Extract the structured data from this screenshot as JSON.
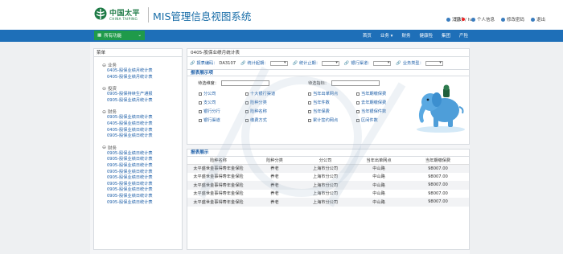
{
  "header": {
    "logo_cn": "中国太平",
    "logo_en": "CHINA TAIPING",
    "system_title": "MIS管理信息视图系统",
    "user_greeting": "您好 / hai",
    "links": [
      {
        "label": "消息",
        "icon": "mail-icon"
      },
      {
        "label": "个人信息",
        "icon": "user-icon"
      },
      {
        "label": "修改密码",
        "icon": "edit-icon"
      },
      {
        "label": "退出",
        "icon": "power-icon"
      }
    ]
  },
  "nav": {
    "functions_label": "所有功能",
    "items": [
      "首页",
      "业务",
      "财务",
      "健康险",
      "集团",
      "产险"
    ]
  },
  "sidebar": {
    "title": "菜单",
    "groups": [
      {
        "label": "业务",
        "items": [
          "0405-股保业绩月统计表",
          "0405-股保业绩月统计表"
        ]
      },
      {
        "label": "投资",
        "items": [
          "0905-股保持续生产通报",
          "0905-股保业绩月统计表"
        ]
      },
      {
        "label": "财务",
        "items": [
          "0905-股保业绩日统计表",
          "0405-股保业绩日统计表",
          "0405-股保业绩日统计表",
          "0905-股保业绩日统计表"
        ]
      },
      {
        "label": "财务",
        "items": [
          "0905-股保业绩日统计表",
          "0905-股保业绩日统计表",
          "0905-股保业绩日统计表",
          "0905-股保业绩日统计表",
          "0905-股保业绩日统计表",
          "0905-股保业绩日统计表",
          "0905-股保业绩日统计表",
          "0905-股保业绩日统计表",
          "0905-股保业绩日统计表"
        ]
      }
    ]
  },
  "main": {
    "panel_title": "0405-股保业绩月统计表",
    "filters": [
      {
        "label": "报表编码：",
        "value": "DA3107"
      },
      {
        "label": "统计起期：",
        "value": ""
      },
      {
        "label": "统计止期：",
        "value": ""
      },
      {
        "label": "银行渠道：",
        "value": ""
      },
      {
        "label": "业务类型：",
        "value": ""
      }
    ],
    "indicator_section": "报表展示项",
    "dim_search_label": "待选维度：",
    "metric_search_label": "待选指标：",
    "dimensions": [
      "分公司",
      "十大银行渠道",
      "支公司",
      "险种分类",
      "银行分行",
      "险种名称",
      "银行渠道",
      "缴费方式"
    ],
    "metrics": [
      "当年出单网点",
      "当年期缴保费",
      "当年件数",
      "去年期缴保费",
      "当年保费",
      "当年银保件数",
      "累计签约网点",
      "区间件数"
    ],
    "report_section": "报表展示",
    "table": {
      "columns": [
        "险种名称",
        "险种分类",
        "分公司",
        "当年出单网点",
        "当年期缴保费"
      ],
      "rows": [
        [
          "太平盛世金事得寿年金保险",
          "养老",
          "上海市分公司",
          "中山路",
          "98007.00"
        ],
        [
          "太平盛世金事得寿年金保险",
          "养老",
          "上海市分公司",
          "中山路",
          "98007.00"
        ],
        [
          "太平盛世金事得寿年金保险",
          "养老",
          "上海市分公司",
          "中山路",
          "98007.00"
        ],
        [
          "太平盛世金事得寿年金保险",
          "养老",
          "上海市分公司",
          "中山路",
          "98007.00"
        ],
        [
          "太平盛世金事得寿年金保险",
          "养老",
          "上海市分公司",
          "中山路",
          "98007.00"
        ]
      ]
    }
  },
  "colors": {
    "brand_green": "#1d7a45",
    "nav_blue": "#1e6fb8",
    "link_blue": "#1e5fa8",
    "functions_green": "#1f9a4a"
  }
}
